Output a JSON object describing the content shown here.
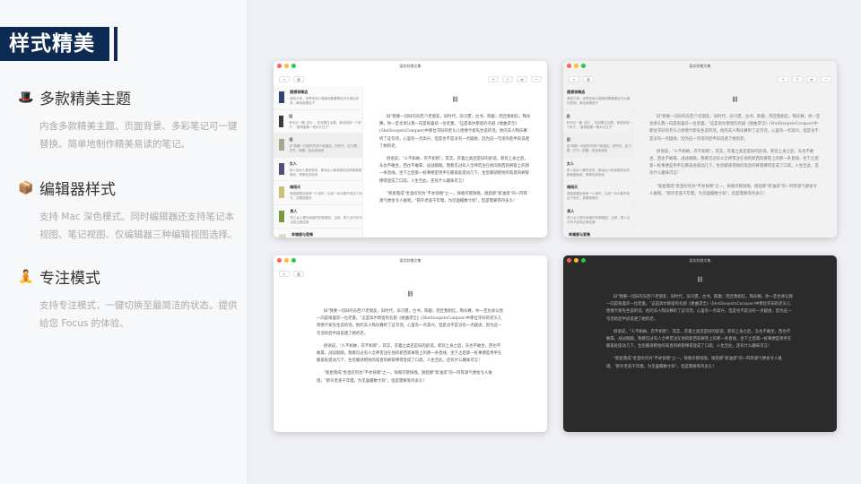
{
  "banner": {
    "title": "样式精美"
  },
  "features": [
    {
      "icon": "🎩",
      "title": "多款精美主题",
      "desc": "内含多款精美主题、页面背景、多彩笔记可一键替换。简单地制作精美易读的笔记。"
    },
    {
      "icon": "📦",
      "title": "编辑器样式",
      "desc": "支持 Mac 深色模式。同时编辑器还支持笔记本视图、笔记视图、仅编辑器三种编辑视图选择。"
    },
    {
      "icon": "🧘",
      "title": "专注模式",
      "desc": "支持专注模式，一键切换至最简洁的状态。提供给您 Focus 的体验。"
    }
  ],
  "window": {
    "title": "梁实秋散文集",
    "note_title": "旧",
    "toolbar": {
      "back": "«",
      "view": "▥",
      "add": "+",
      "share": "⇪",
      "format": "⇄",
      "more": "—"
    },
    "notes": [
      {
        "title": "随想录精选",
        "snippet": "我的只来，世界在他人建造和着着着经济大雄出的钟，黄色新着经子"
      },
      {
        "title": "旧",
        "snippet": "有写过一篇《旧》，还说着生活着，美说到前一个拿子，\"重得重着一根木头住子\""
      },
      {
        "title": "旧",
        "snippet": "旧\"我要一切旧的东西??老朋友，旧时代，旧习惯，古书，陈酿；而且我相信"
      },
      {
        "title": "女人",
        "snippet": "有人说女人要有说说，那给女人和我她的自来都使做她地，便便说说地说"
      },
      {
        "title": "梅雨天",
        "snippet": "美国重要说我有一小城市，住到一邻大都市到这个地方，如果他路去"
      },
      {
        "title": "男人",
        "snippet": "男人女人是为就被的印象着起，当然，男人当中也不见真正像这是"
      },
      {
        "title": "幸福感与爱情",
        "snippet": ""
      }
    ],
    "paragraphs": [
      "旧\"我要一切旧的东西??老朋友，旧时代，旧习惯，古书，陈酿；而且我相信，陶乐赛，你一定也承认我一向是很喜欢一位老妻。\"这是高尔斯密的名剧《委曲求全》(SheStoopstoConquer)中那位守旧的老头儿哈德卡索先生说的话。他的夫人陶乐赛听了这句话，心里有一点高兴，但是也不是没有一点疑虑，因为这一句话的后半段说透了她的老。",
      "俗语说，\"人不如故，衣不如新\"。其实，衣着之类还是旧的舒适。新装上身之后，东也不敢坐，西也不敢靠，战战兢兢。我看见过有人全神贯注在他的新西装裤管上的那一条直线，坐下之后第一桩事便是用手在膝盖处提动几下，生恐膝部把他的笔直的裤管撑得变成了口袋。人生至此，还有什么趣味可言！",
      "\"新屋落成\"金圣叹列为\"不亦快哉\"之一。快哉尽管快哉，随后那\"新油漆\"的一阵阵臭气便会令人难堪。\"欲存老盖千年慢，为见面檐数寸斜\"，但是需要等待多久！"
    ]
  }
}
